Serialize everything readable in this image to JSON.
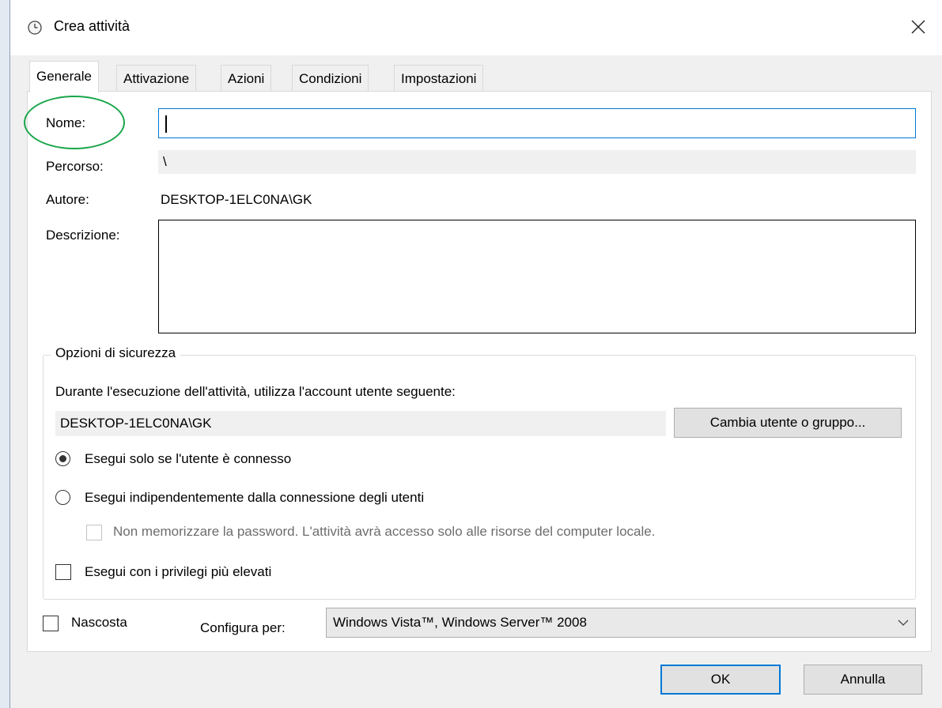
{
  "window": {
    "title": "Crea attività",
    "close_icon": "close-icon",
    "clock_icon": "clock-icon"
  },
  "tabs": [
    {
      "label": "Generale",
      "active": true
    },
    {
      "label": "Attivazione",
      "active": false
    },
    {
      "label": "Azioni",
      "active": false
    },
    {
      "label": "Condizioni",
      "active": false
    },
    {
      "label": "Impostazioni",
      "active": false
    }
  ],
  "general": {
    "name_label": "Nome:",
    "name_value": "",
    "path_label": "Percorso:",
    "path_value": "\\",
    "author_label": "Autore:",
    "author_value": "DESKTOP-1ELC0NA\\GK",
    "description_label": "Descrizione:",
    "description_value": ""
  },
  "security": {
    "legend": "Opzioni di sicurezza",
    "account_prompt": "Durante l'esecuzione dell'attività, utilizza l'account utente seguente:",
    "account_value": "DESKTOP-1ELC0NA\\GK",
    "change_user_button": "Cambia utente o gruppo...",
    "radio_logged_on": "Esegui solo se l'utente è connesso",
    "radio_logged_on_selected": true,
    "radio_whether_logged": "Esegui indipendentemente dalla connessione degli utenti",
    "radio_whether_logged_selected": false,
    "no_store_password": "Non memorizzare la password. L'attività avrà accesso solo alle risorse del computer locale.",
    "highest_privileges": "Esegui con i privilegi più elevati"
  },
  "bottom": {
    "hidden_label": "Nascosta",
    "configure_for_label": "Configura per:",
    "configure_for_value": "Windows Vista™, Windows Server™ 2008"
  },
  "buttons": {
    "ok": "OK",
    "cancel": "Annulla"
  },
  "colors": {
    "annotation_ellipse": "#1aa64a",
    "focus_blue": "#0078d7"
  }
}
